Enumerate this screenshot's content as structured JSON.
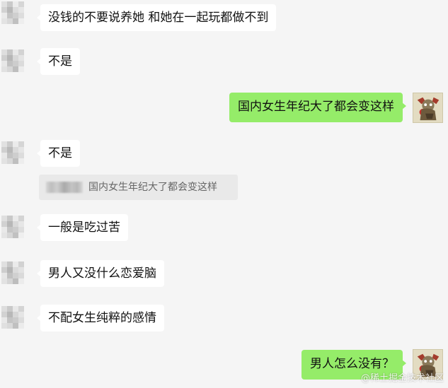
{
  "colors": {
    "background": "#f5f5f5",
    "incoming_bubble": "#ffffff",
    "outgoing_bubble": "#95ec69",
    "quote_bg": "#e9e9e9"
  },
  "messages": [
    {
      "side": "left",
      "text": "没钱的不要说养她 和她在一起玩都做不到"
    },
    {
      "side": "left",
      "text": "不是"
    },
    {
      "side": "right",
      "text": "国内女生年纪大了都会变这样"
    },
    {
      "side": "left",
      "text": "不是"
    },
    {
      "side": "left",
      "text": "一般是吃过苦"
    },
    {
      "side": "left",
      "text": "男人又没什么恋爱脑"
    },
    {
      "side": "left",
      "text": "不配女生纯粹的感情"
    },
    {
      "side": "right",
      "text": "男人怎么没有？"
    }
  ],
  "quote": {
    "text": "国内女生年纪大了都会变这样"
  },
  "watermark": "@稀土掘金技术社区",
  "icons": {
    "incoming_avatar": "pixelated-avatar-icon",
    "outgoing_avatar": "cartoon-character-avatar-icon"
  }
}
